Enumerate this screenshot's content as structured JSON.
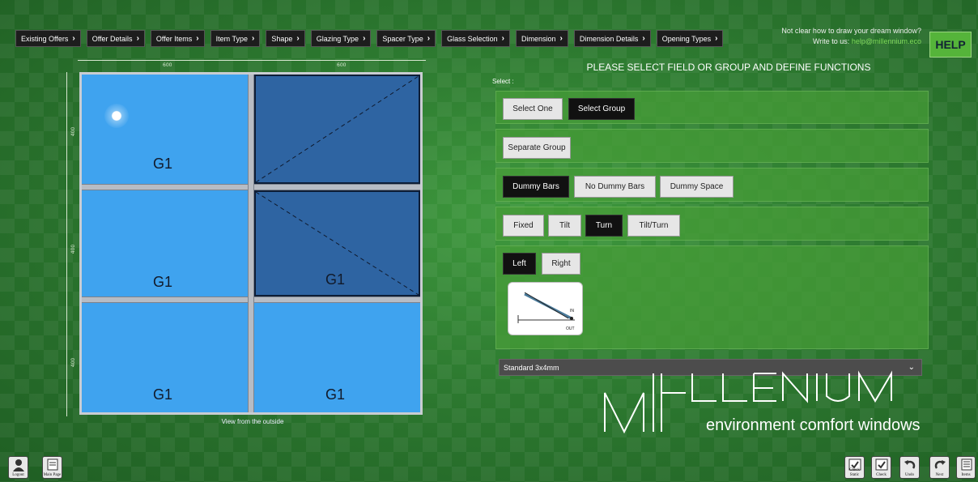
{
  "nav": {
    "items": [
      "Existing Offers",
      "Offer Details",
      "Offer Items",
      "Item Type",
      "Shape",
      "Glazing Type",
      "Spacer Type",
      "Glass Selection",
      "Dimension",
      "Dimension Details",
      "Opening Types"
    ]
  },
  "help": {
    "question": "Not clear how to draw your dream window?",
    "write_prefix": "Write to us:",
    "email": "help@millennium.eco",
    "button": "HELP"
  },
  "drawing": {
    "dim_top": [
      "600",
      "600"
    ],
    "dim_left": [
      "400",
      "400",
      "400"
    ],
    "pane_label": "G1",
    "view_label": "View from the outside"
  },
  "panel": {
    "title": "PLEASE SELECT FIELD OR GROUP AND DEFINE FUNCTIONS",
    "select_label": "Select :",
    "select_one": "Select One",
    "select_group": "Select Group",
    "separate_group": "Separate Group",
    "dummy_bars": "Dummy Bars",
    "no_dummy_bars": "No Dummy Bars",
    "dummy_space": "Dummy Space",
    "fixed": "Fixed",
    "tilt": "Tilt",
    "turn": "Turn",
    "tilt_turn": "Tilt/Turn",
    "left": "Left",
    "right": "Right",
    "diagram_in": "IN",
    "diagram_out": "OUT",
    "dropdown_value": "Standard 3x4mm"
  },
  "brand": {
    "tagline": "environment comfort windows"
  },
  "bottom": {
    "logout": "Logout",
    "main_page": "Main Page",
    "check_static": "Check Static",
    "check": "Check",
    "undo": "Undo",
    "next": "Next",
    "items": "Items"
  }
}
